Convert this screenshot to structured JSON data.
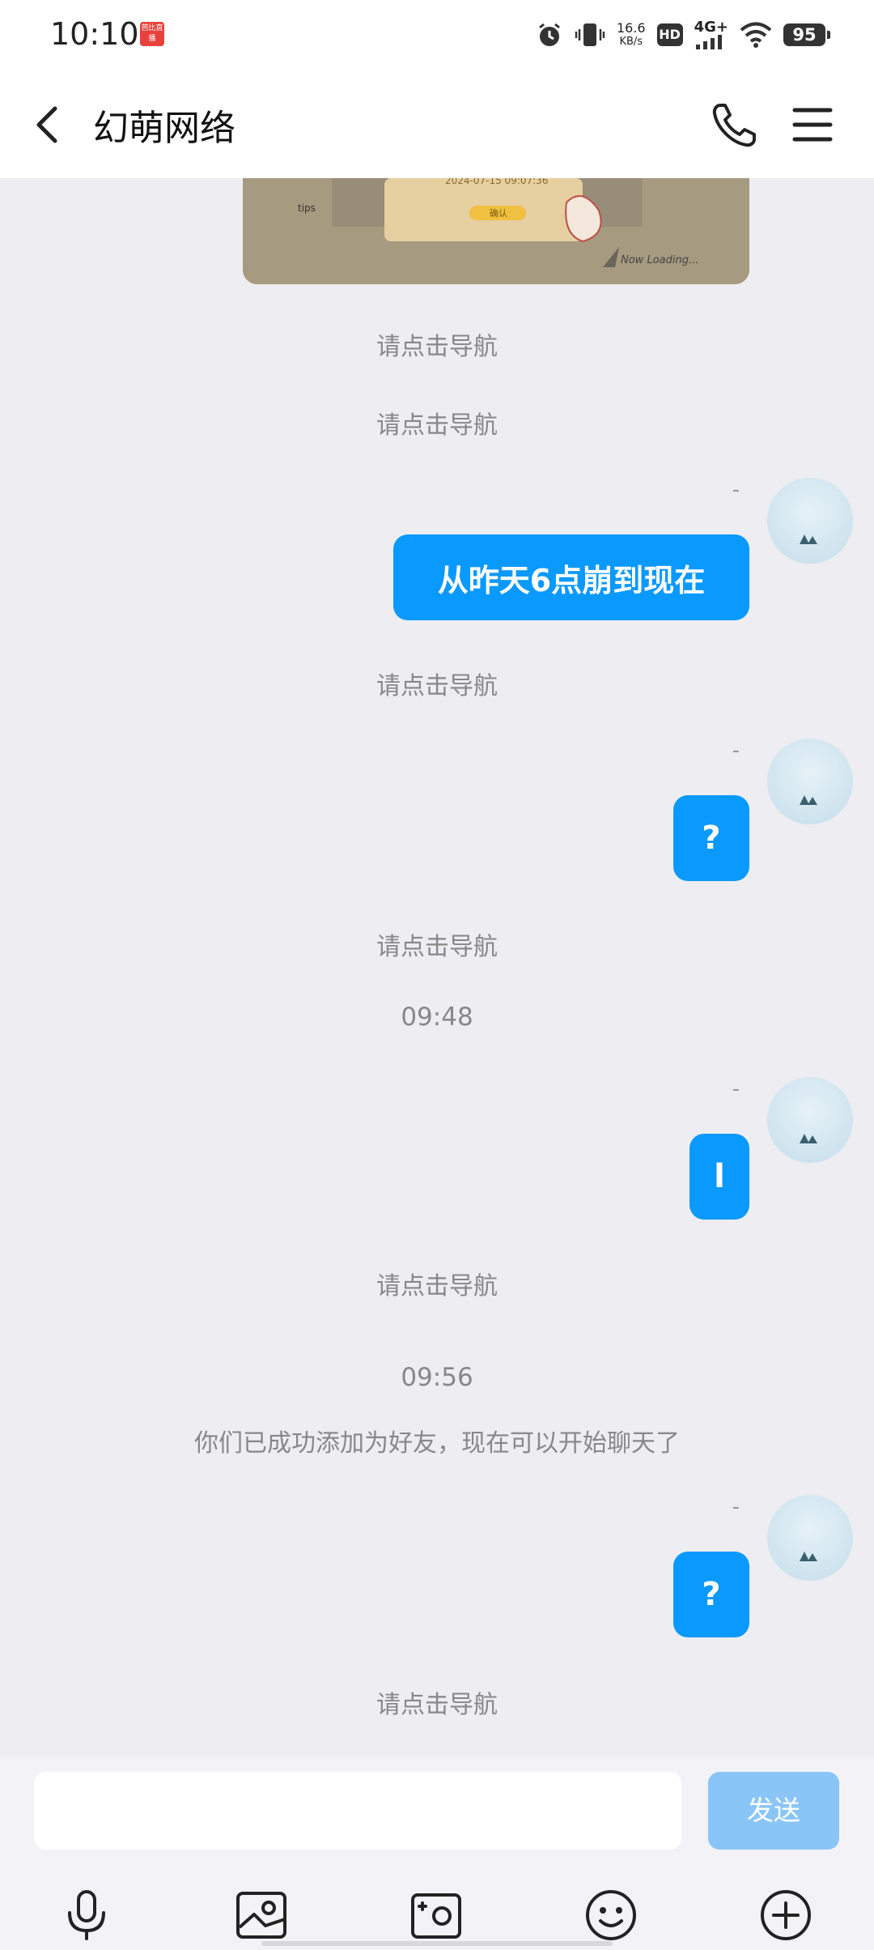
{
  "status_bar": {
    "time": "10:10",
    "badge_text": "芭比直播",
    "net_speed": "16.6",
    "net_speed_unit": "KB/s",
    "hd": "HD",
    "network": "4G+",
    "battery": "95"
  },
  "header": {
    "title": "幻萌网络"
  },
  "chat": {
    "nav_prompt": "请点击导航",
    "sender_dash": "-",
    "messages": [
      {
        "type": "system",
        "text": "请点击导航"
      },
      {
        "type": "system",
        "text": "请点击导航"
      },
      {
        "type": "sent",
        "text": "从昨天6点崩到现在"
      },
      {
        "type": "system",
        "text": "请点击导航"
      },
      {
        "type": "sent",
        "text": "?"
      },
      {
        "type": "system",
        "text": "请点击导航"
      },
      {
        "type": "time",
        "text": "09:48"
      },
      {
        "type": "sent",
        "text": "l"
      },
      {
        "type": "system",
        "text": "请点击导航"
      },
      {
        "type": "time",
        "text": "09:56"
      },
      {
        "type": "system",
        "text": "你们已成功添加为好友，现在可以开始聊天了"
      },
      {
        "type": "sent",
        "text": "?"
      },
      {
        "type": "system",
        "text": "请点击导航"
      }
    ],
    "image_msg": {
      "date_text": "2024-07-15 09:07:36",
      "button_text": "确认",
      "tips_label": "tips",
      "loading_text": "Now Loading..."
    }
  },
  "input": {
    "value": "",
    "placeholder": "",
    "send_label": "发送"
  },
  "toolbar": {
    "icons": [
      "microphone-icon",
      "photo-icon",
      "camera-icon",
      "emoji-icon",
      "plus-icon"
    ]
  },
  "colors": {
    "bubble": "#0a99ff",
    "send_disabled": "#8ac5f8",
    "background": "#ededf2"
  }
}
